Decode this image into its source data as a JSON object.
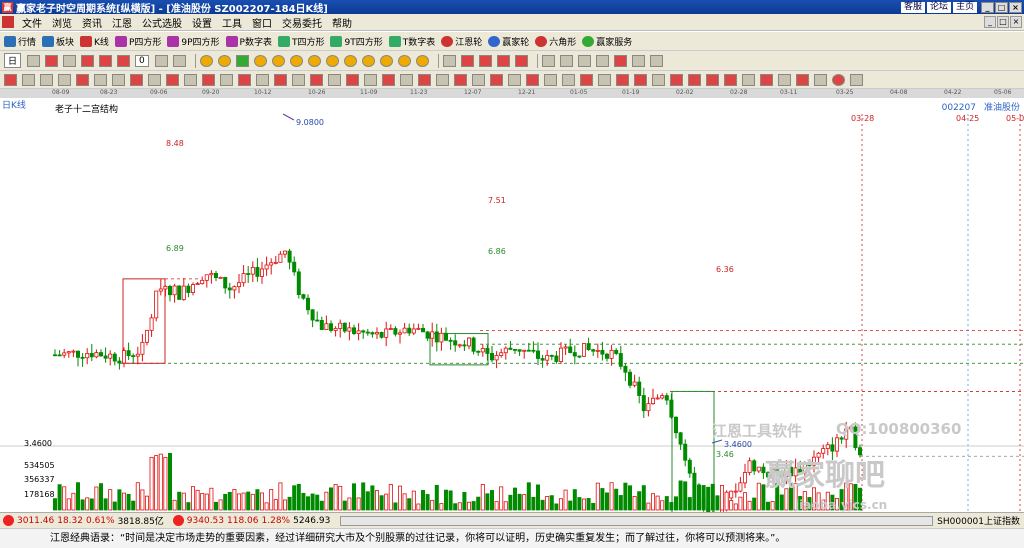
{
  "app": {
    "logo": "赢",
    "title": "赢家老子时空周期系统[纵横版] - [准油股份  SZ002207-184日K线]",
    "links": [
      "客服",
      "论坛",
      "主页"
    ],
    "window_buttons": [
      "_",
      "□",
      "×"
    ]
  },
  "menu": [
    "文件",
    "浏览",
    "资讯",
    "江恩",
    "公式选股",
    "设置",
    "工具",
    "窗口",
    "交易委托",
    "帮助"
  ],
  "toolbar1": [
    "行情",
    "板块",
    "K线",
    "P四方形",
    "9P四方形",
    "P数字表",
    "T四方形",
    "9T四方形",
    "T数字表",
    "江恩轮",
    "赢家轮",
    "六角形",
    "赢家服务"
  ],
  "tb2": {
    "combo": "日",
    "num": "0"
  },
  "dates": [
    "08-09",
    "08-23",
    "09-06",
    "09-20",
    "10-12",
    "10-26",
    "11-09",
    "11-23",
    "12-07",
    "12-21",
    "01-05",
    "01-19",
    "02-02",
    "02-28",
    "03-11",
    "03-25",
    "04-08",
    "04-22",
    "05-06"
  ],
  "chart": {
    "period": "日K线",
    "structure": "老子十二宫结构",
    "code": "002207",
    "name": "准油股份",
    "marks": {
      "high": "9.0800",
      "low": "3.4600",
      "low_short": "3.46",
      "box1_top": "8.48",
      "box1_bot": "6.89",
      "box2_top": "7.51",
      "box2_bot": "6.86",
      "box3_top": "6.36"
    },
    "dates_marked": [
      "03-28",
      "04-25",
      "05-0"
    ],
    "axis_low": "3.4600",
    "vol_ticks": [
      "534505",
      "356337",
      "178168"
    ]
  },
  "watermark": {
    "software": "江恩工具软件",
    "qq": "QQ:100800360",
    "forum": "赢家聊吧",
    "url": "jiaoba.yjcs.cn"
  },
  "status": {
    "idx1": {
      "value": "3011.46",
      "change": "18.32",
      "pct": "0.61%",
      "amount": "3818.85亿"
    },
    "idx2": {
      "value": "9340.53",
      "change": "118.06",
      "pct": "1.28%",
      "amount": "5246.93"
    },
    "code": "SH000001上证指数"
  },
  "quote": "江恩经典语录：“时间是决定市场走势的重要因素，经过详细研究大市及个别股票的过往记录，你将可以证明，历史确实重复发生；而了解过往，你将可以预测将来。”。",
  "colors": {
    "up": "#e01010",
    "down": "#008a00",
    "box": "#cc2222"
  }
}
